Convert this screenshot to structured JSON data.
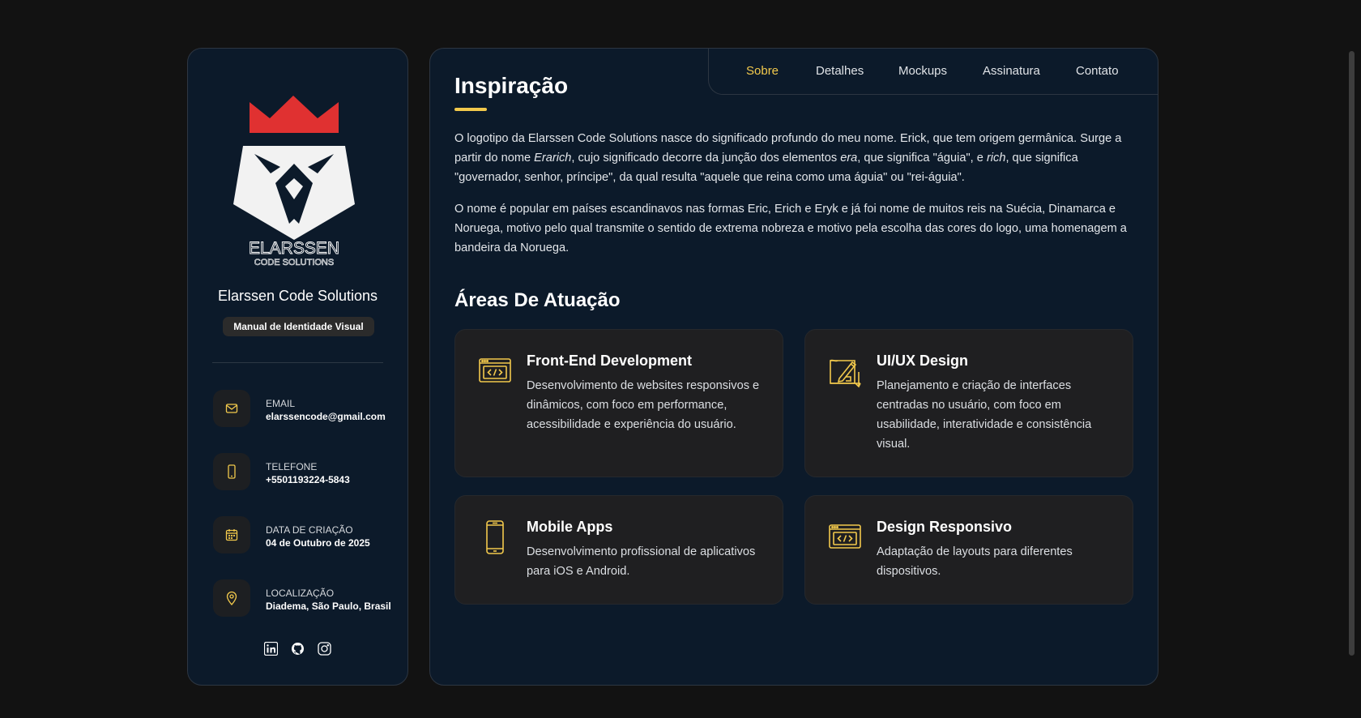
{
  "sidebar": {
    "logo": {
      "word1": "ELARSSEN",
      "word2": "CODE SOLUTIONS"
    },
    "company_name": "Elarssen Code Solutions",
    "badge": "Manual de Identidade Visual",
    "info": [
      {
        "icon": "mail-icon",
        "label": "EMAIL",
        "value": "elarssencode@gmail.com"
      },
      {
        "icon": "phone-icon",
        "label": "TELEFONE",
        "value": "+5501193224-5843"
      },
      {
        "icon": "calendar-icon",
        "label": "DATA DE CRIAÇÃO",
        "value": "04 de Outubro de 2025"
      },
      {
        "icon": "location-pin-icon",
        "label": "LOCALIZAÇÃO",
        "value": "Diadema, São Paulo, Brasil"
      }
    ],
    "socials": [
      "linkedin-icon",
      "github-icon",
      "instagram-icon"
    ]
  },
  "nav": {
    "items": [
      {
        "label": "Sobre",
        "active": true
      },
      {
        "label": "Detalhes"
      },
      {
        "label": "Mockups"
      },
      {
        "label": "Assinatura"
      },
      {
        "label": "Contato"
      }
    ]
  },
  "main": {
    "title": "Inspiração",
    "p1": {
      "t1": "O logotipo da Elarssen Code Solutions nasce do significado profundo do meu nome. Erick, que tem origem germânica. Surge a partir do nome ",
      "e1": "Erarich",
      "t2": ", cujo significado decorre da junção dos elementos ",
      "e2": "era",
      "t3": ", que significa \"águia\", e ",
      "e3": "rich",
      "t4": ", que significa \"governador, senhor, príncipe\", da qual resulta \"aquele que reina como uma águia\" ou \"rei-águia\"."
    },
    "p2": "O nome é popular em países escandinavos nas formas Eric, Erich e Eryk e já foi nome de muitos reis na Suécia, Dinamarca e Noruega, motivo pelo qual transmite o sentido de extrema nobreza e motivo pela escolha das cores do logo, uma homenagem a bandeira da Noruega.",
    "areas_title": "Áreas De Atuação",
    "cards": [
      {
        "icon": "code-browser-icon",
        "title": "Front-End Development",
        "desc": "Desenvolvimento de websites responsivos e dinâmicos, com foco em performance, acessibilidade e experiência do usuário."
      },
      {
        "icon": "design-tools-icon",
        "title": "UI/UX Design",
        "desc": "Planejamento e criação de interfaces centradas no usuário, com foco em usabilidade, interatividade e consistência visual."
      },
      {
        "icon": "mobile-phone-icon",
        "title": "Mobile Apps",
        "desc": "Desenvolvimento profissional de aplicativos para iOS e Android."
      },
      {
        "icon": "responsive-code-icon",
        "title": "Design Responsivo",
        "desc": "Adaptação de layouts para diferentes dispositivos."
      }
    ]
  },
  "colors": {
    "accent": "#f2c94c",
    "panel": "#0c1a2a",
    "crown_red": "#e03131",
    "card": "#1f1f21"
  }
}
